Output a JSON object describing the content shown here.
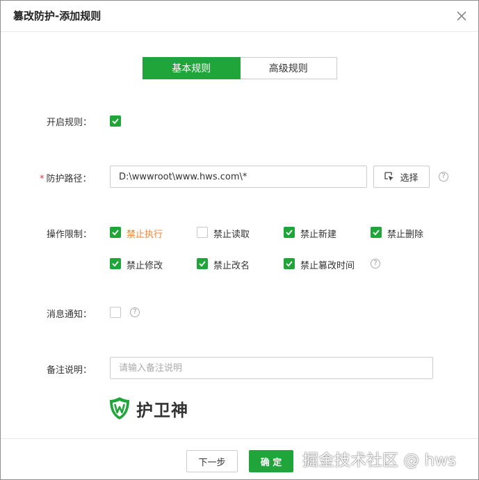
{
  "dialog": {
    "title": "篡改防护-添加规则",
    "close_icon": "close-icon"
  },
  "tabs": [
    {
      "label": "基本规则",
      "active": true
    },
    {
      "label": "高级规则",
      "active": false
    }
  ],
  "form": {
    "enable_rule": {
      "label": "开启规则：",
      "checked": true
    },
    "path": {
      "required_mark": "*",
      "label": "防护路径：",
      "value": "D:\\wwwroot\\www.hws.com\\*",
      "select_label": "选择",
      "select_icon": "select-path-icon",
      "help_icon": "question-icon"
    },
    "operation_limits": {
      "label": "操作限制：",
      "options": [
        {
          "label": "禁止执行",
          "checked": true,
          "highlight": true
        },
        {
          "label": "禁止读取",
          "checked": false,
          "highlight": false
        },
        {
          "label": "禁止新建",
          "checked": true,
          "highlight": false
        },
        {
          "label": "禁止删除",
          "checked": true,
          "highlight": false
        },
        {
          "label": "禁止修改",
          "checked": true,
          "highlight": false
        },
        {
          "label": "禁止改名",
          "checked": true,
          "highlight": false
        },
        {
          "label": "禁止篡改时间",
          "checked": true,
          "highlight": false
        }
      ],
      "help_icon": "question-icon"
    },
    "notify": {
      "label": "消息通知：",
      "checked": false,
      "help_icon": "question-icon"
    },
    "remark": {
      "label": "备注说明：",
      "placeholder": "请输入备注说明",
      "value": ""
    }
  },
  "logo": {
    "text": "护卫神",
    "icon": "shield-w-logo-icon"
  },
  "footer": {
    "next_label": "下一步",
    "ok_label": "确 定"
  },
  "watermark": "掘金技术社区 @ hws",
  "colors": {
    "accent": "#20a53a",
    "warn_text": "#f0802e",
    "required": "#e23a3a"
  }
}
